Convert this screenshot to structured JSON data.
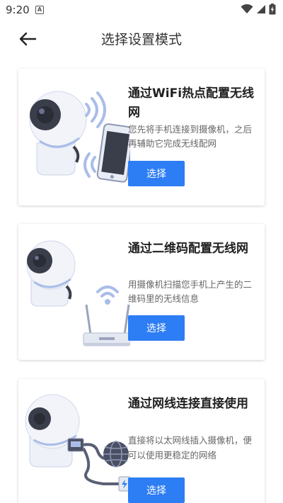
{
  "status_bar": {
    "time": "9:20",
    "notification_glyph": "A",
    "icons": [
      "wifi-icon",
      "signal-icon",
      "battery-charging-icon"
    ]
  },
  "header": {
    "title": "选择设置模式",
    "back_icon": "arrow-left-icon"
  },
  "modes": [
    {
      "title": "通过WiFi热点配置无线网",
      "description": "您先将手机连接到摄像机，之后再辅助它完成无线配网",
      "button_label": "选择",
      "illustration": "camera-phone-wifi"
    },
    {
      "title": "通过二维码配置无线网",
      "description": "用摄像机扫描您手机上产生的二维码里的无线信息",
      "button_label": "选择",
      "illustration": "camera-router"
    },
    {
      "title": "通过网线连接直接使用",
      "description": "直接将以太网线插入摄像机，便可以使用更稳定的网络",
      "button_label": "选择",
      "illustration": "camera-ethernet-globe"
    }
  ],
  "colors": {
    "accent": "#2d7df5",
    "illustration_blue": "#a9bde8",
    "camera_dark": "#3a3d4a"
  }
}
